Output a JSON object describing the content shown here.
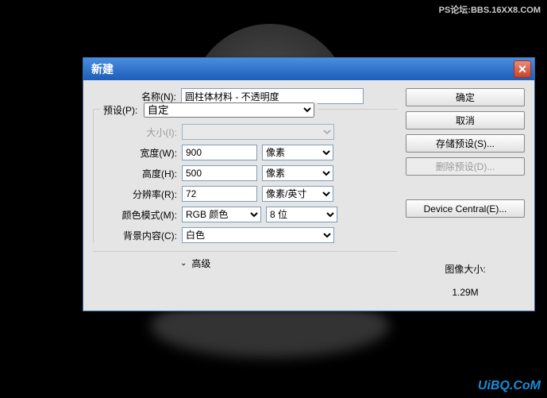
{
  "watermark_top": "PS论坛:BBS.16XX8.COM",
  "watermark_bottom": "UiBQ.CoM",
  "dialog": {
    "title": "新建",
    "name_label": "名称(N):",
    "name_value": "圆柱体材料 - 不透明度",
    "preset_label": "预设(P):",
    "preset_value": "自定",
    "size_label": "大小(I):",
    "width_label": "宽度(W):",
    "width_value": "900",
    "width_unit": "像素",
    "height_label": "高度(H):",
    "height_value": "500",
    "height_unit": "像素",
    "res_label": "分辨率(R):",
    "res_value": "72",
    "res_unit": "像素/英寸",
    "colormode_label": "颜色模式(M):",
    "colormode_value": "RGB 颜色",
    "bit_value": "8 位",
    "bgcontent_label": "背景内容(C):",
    "bgcontent_value": "白色",
    "advanced_label": "高级",
    "buttons": {
      "ok": "确定",
      "cancel": "取消",
      "save_preset": "存储预设(S)...",
      "delete_preset": "删除预设(D)...",
      "device_central": "Device Central(E)..."
    },
    "imgsize_label": "图像大小:",
    "imgsize_value": "1.29M"
  }
}
